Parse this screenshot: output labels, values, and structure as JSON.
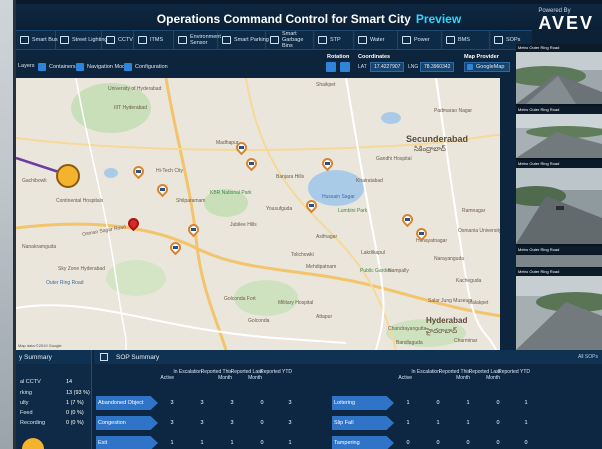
{
  "header": {
    "title": "Operations Command Control for Smart City",
    "preview": "Preview",
    "powered_by": "Powered By",
    "logo": "AVEV"
  },
  "nav": [
    {
      "label": "Smart Bus",
      "icon": "bus-icon"
    },
    {
      "label": "Street Lighting",
      "icon": "streetlight-icon"
    },
    {
      "label": "CCTV",
      "icon": "cctv-icon"
    },
    {
      "label": "ITMS",
      "icon": "traffic-icon"
    },
    {
      "label": "Environment Sensor",
      "icon": "sensor-icon"
    },
    {
      "label": "Smart Parking",
      "icon": "parking-icon"
    },
    {
      "label": "Smart Garbage Bins",
      "icon": "bin-icon"
    },
    {
      "label": "STP",
      "icon": "stp-icon"
    },
    {
      "label": "Water",
      "icon": "water-icon"
    },
    {
      "label": "Power",
      "icon": "power-icon"
    },
    {
      "label": "BMS",
      "icon": "bms-icon"
    },
    {
      "label": "SOPs",
      "icon": "sop-icon"
    }
  ],
  "toolbar": {
    "layers": "Layers",
    "containers": "Containers",
    "navigation_model": "Navigation Model",
    "configuration": "Configuration",
    "rotation_label": "Rotation",
    "coordinates_label": "Coordinates",
    "lat_label": "LAT",
    "lat_value": "17.4227907",
    "lng_label": "LNG",
    "lng_value": "78.3960342",
    "map_provider_label": "Map Provider",
    "map_provider_value": "GoogleMap"
  },
  "map": {
    "labels": [
      "University of Hyderabad",
      "IIIT Hyderabad",
      "Shaikpet",
      "Golconda",
      "Tolichowki",
      "Hi-Tech City",
      "Madhapur",
      "Jubilee Hills",
      "Banjara Hills",
      "Khairatabad",
      "Secunderabad",
      "సికింద్రాబాద్",
      "Hyderabad",
      "హైదరాబాద్",
      "Mehdipatnam",
      "Lakdikapul",
      "Attapur",
      "Nampally",
      "Himayatnagar",
      "Kacheguda",
      "Malakpet",
      "Ramnagar",
      "Padmarao Nagar",
      "Narayanguda",
      "Yousufguda",
      "Continental Hospitals",
      "Nanakramguda",
      "Gachibowli",
      "Sky Zone Hyderabad",
      "Outer Ring Road",
      "Osman Sagar Road",
      "Charminar",
      "Chandrayangutta",
      "Hussain Sagar",
      "Gandhi Hospital",
      "Shilparamam",
      "KBR National Park",
      "Military Hospital",
      "Golconda Fort",
      "Bandlaguda",
      "Asifnagar",
      "Public Garden",
      "Salar Jung Museum",
      "Lumbini Park",
      "Osmania University"
    ],
    "copyright": "Map data ©2019 Google"
  },
  "cameras": [
    {
      "title": "Metro Outer Ring Road"
    },
    {
      "title": "Metro Outer Ring Road"
    },
    {
      "title": "Metro Outer Ring Road"
    },
    {
      "title": "Metro Outer Ring Road"
    },
    {
      "title": "Metro Outer Ring Road"
    }
  ],
  "summary": {
    "title": "y Summary",
    "rows": [
      {
        "label": "al CCTV",
        "value": "14"
      },
      {
        "label": "rking",
        "value": "13 (93 %)"
      },
      {
        "label": "ulty",
        "value": "1 (7 %)"
      },
      {
        "label": "Feed",
        "value": "0 (0 %)"
      },
      {
        "label": "Recording",
        "value": "0 (0 %)"
      }
    ]
  },
  "sop": {
    "title": "SOP Summary",
    "all_label": "All SOPs",
    "columns": [
      "Active",
      "In Escalation",
      "Reported This Month",
      "Reported Last Month",
      "Reported YTD"
    ],
    "left_rows": [
      {
        "label": "Abandoned Object",
        "values": [
          "3",
          "3",
          "3",
          "0",
          "3"
        ]
      },
      {
        "label": "Congestion",
        "values": [
          "3",
          "3",
          "3",
          "0",
          "3"
        ]
      },
      {
        "label": "Exit",
        "values": [
          "1",
          "1",
          "1",
          "0",
          "1"
        ]
      }
    ],
    "right_rows": [
      {
        "label": "Loitering",
        "values": [
          "1",
          "0",
          "1",
          "0",
          "1"
        ]
      },
      {
        "label": "Slip Fall",
        "values": [
          "1",
          "1",
          "1",
          "0",
          "1"
        ]
      },
      {
        "label": "Tampering",
        "values": [
          "0",
          "0",
          "0",
          "0",
          "0"
        ]
      }
    ]
  },
  "colors": {
    "accent": "#2fd4ff",
    "header_bg": "#0e2740",
    "sop_label_bg": "#2f74c6",
    "cluster": "#f3b32c"
  }
}
